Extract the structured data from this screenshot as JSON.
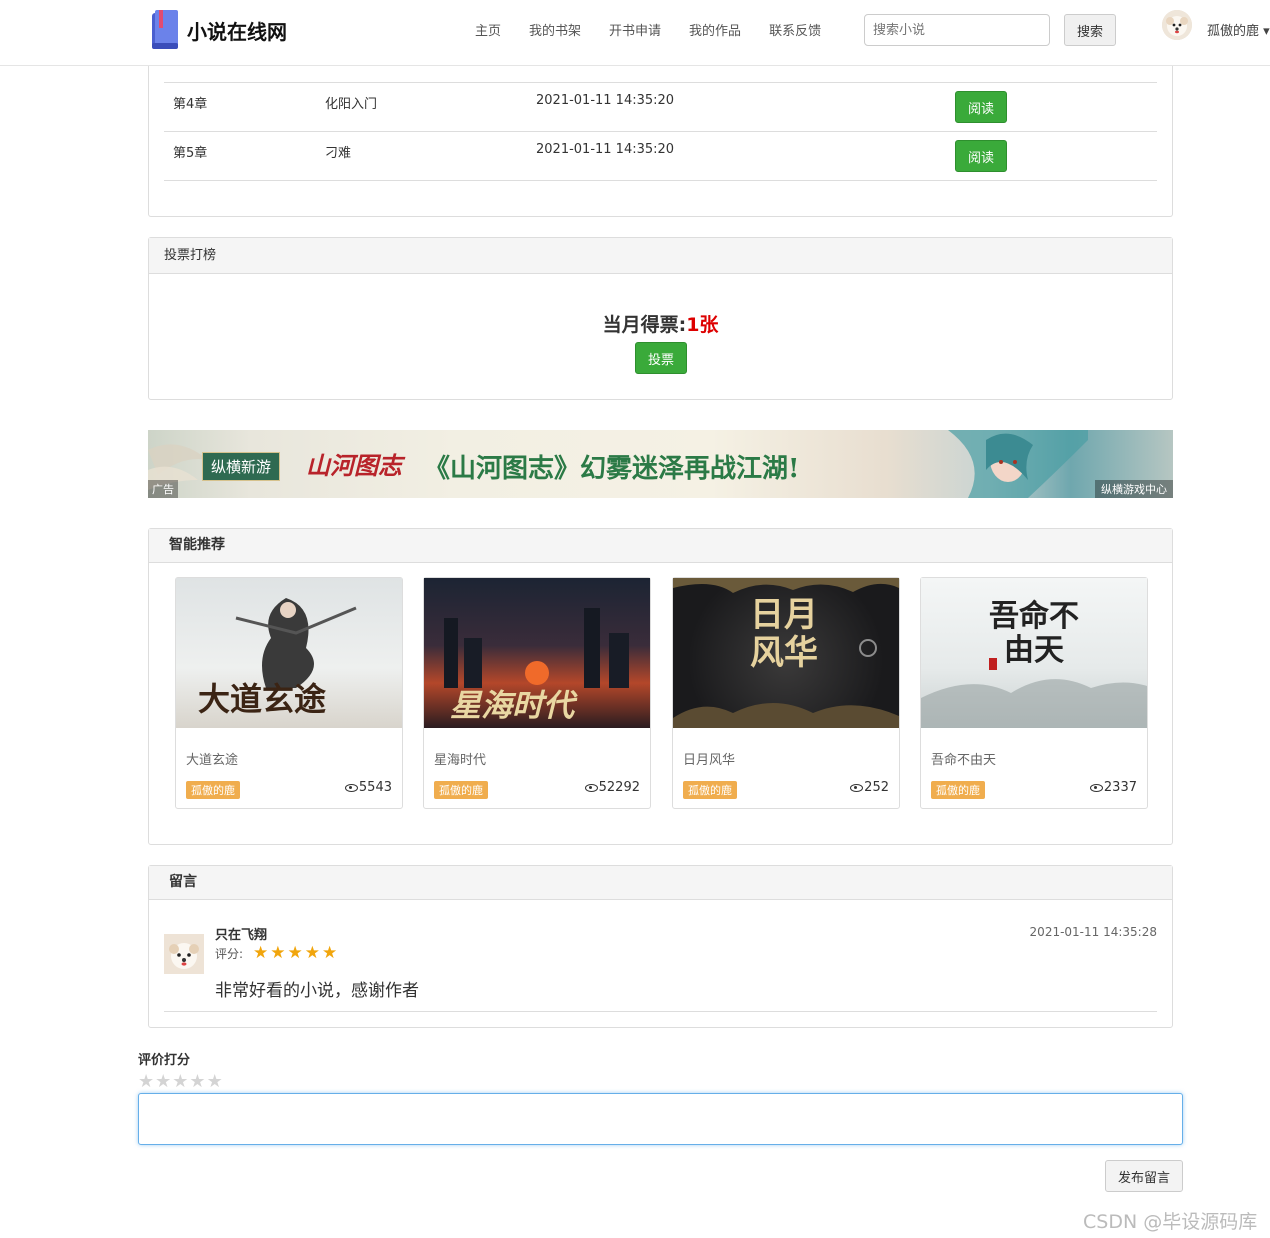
{
  "header": {
    "brand": "小说在线网",
    "nav": [
      "主页",
      "我的书架",
      "开书申请",
      "我的作品",
      "联系反馈"
    ],
    "search_placeholder": "搜索小说",
    "search_button": "搜索",
    "username": "孤傲的鹿"
  },
  "chapters": [
    {
      "number": "第4章",
      "title": "化阳入门",
      "time": "2021-01-11 14:35:20",
      "action": "阅读"
    },
    {
      "number": "第5章",
      "title": "刁难",
      "time": "2021-01-11 14:35:20",
      "action": "阅读"
    }
  ],
  "vote": {
    "heading": "投票打榜",
    "label": "当月得票:",
    "count": "1张",
    "button": "投票"
  },
  "ad": {
    "badge": "纵横新游",
    "title_part1": "《山河图志》",
    "title_part2": "幻雾迷泽再战江湖!",
    "logo_text": "山河图志",
    "label": "广告",
    "source": "纵横游戏中心"
  },
  "recommend": {
    "heading": "智能推荐",
    "books": [
      {
        "title": "大道玄途",
        "author": "孤傲的鹿",
        "views": "5543",
        "cover_text": "大道玄途"
      },
      {
        "title": "星海时代",
        "author": "孤傲的鹿",
        "views": "52292",
        "cover_text": "星海时代"
      },
      {
        "title": "日月风华",
        "author": "孤傲的鹿",
        "views": "252",
        "cover_text": "日月风华"
      },
      {
        "title": "吾命不由天",
        "author": "孤傲的鹿",
        "views": "2337",
        "cover_text": "吾命不由天"
      }
    ]
  },
  "comments": {
    "heading": "留言",
    "items": [
      {
        "user": "只在飞翔",
        "time": "2021-01-11 14:35:28",
        "rating_label": "评分:",
        "rating": 5,
        "text": "非常好看的小说，感谢作者"
      }
    ]
  },
  "form": {
    "rate_label": "评价打分",
    "rating": 0,
    "submit": "发布留言"
  },
  "watermark": "CSDN @毕设源码库",
  "colors": {
    "green": "#3aaa3a",
    "orange": "#f0ad4e",
    "red": "#dd0000",
    "star": "#f1a50c"
  }
}
